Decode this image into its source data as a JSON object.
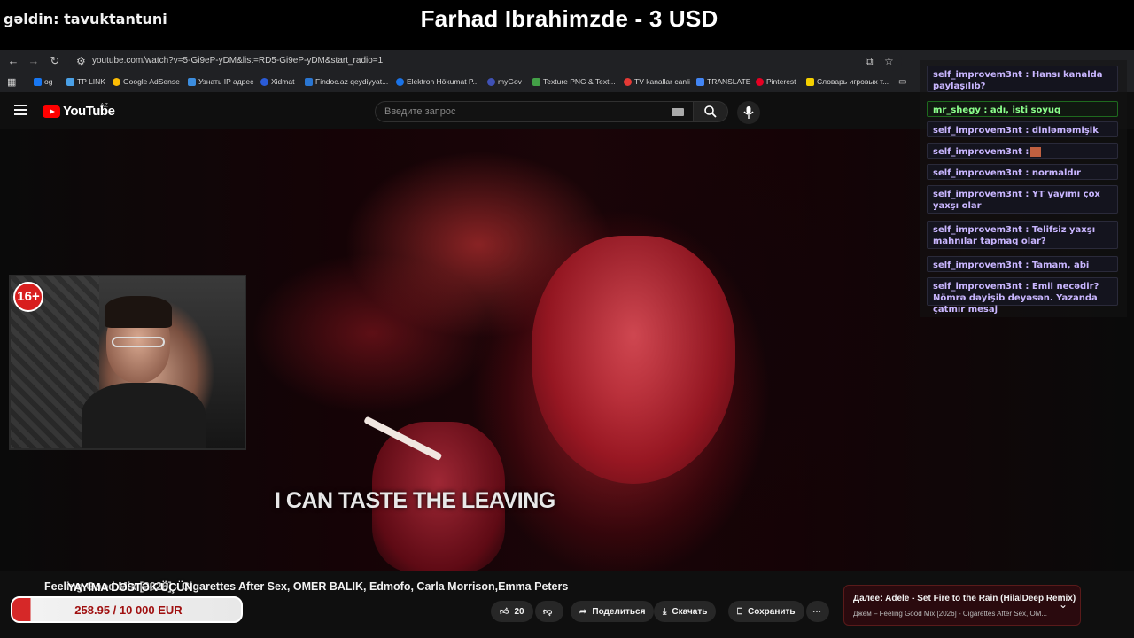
{
  "stream": {
    "greeting": "gəldin: tavuktantuni",
    "title": "Farhad Ibrahimzde - 3 USD",
    "age_badge": "16+",
    "support_text": "YAYIMA DƏSTƏK ÜÇÜN",
    "donation_progress": "258.95 / 10 000 EUR"
  },
  "browser": {
    "url": "youtube.com/watch?v=5-Gi9eP-yDM&list=RD5-Gi9eP-yDM&start_radio=1",
    "bookmarks": [
      {
        "label": "og",
        "color": "#1877f2"
      },
      {
        "label": "TP LINK",
        "color": "#4aa0e6"
      },
      {
        "label": "Google AdSense",
        "color": "#fbbc04"
      },
      {
        "label": "Узнать IP адрес",
        "color": "#3c8dde"
      },
      {
        "label": "Xidmat",
        "color": "#2a5bd7"
      },
      {
        "label": "Findoc.az qeydiyyat...",
        "color": "#2a76d2"
      },
      {
        "label": "Elektron Hökumat P...",
        "color": "#1a73e8"
      },
      {
        "label": "myGov",
        "color": "#3f51b5"
      },
      {
        "label": "Texture PNG & Text...",
        "color": "#43a047"
      },
      {
        "label": "TV kanallar canli",
        "color": "#e53935"
      },
      {
        "label": "TRANSLATE",
        "color": "#4285f4"
      },
      {
        "label": "Pinterest",
        "color": "#e60023"
      },
      {
        "label": "Словарь игровых т...",
        "color": "#f5d000"
      }
    ]
  },
  "youtube": {
    "logo_text": "YouTube",
    "region": "AZ",
    "search_placeholder": "Введите запрос",
    "subtitle": "I CAN TASTE THE LEAVING",
    "video_title": "Feeling Good Mix [2026] - Cigarettes After Sex, OMER BALIK, Edmofo, Carla Morrison,Emma Peters",
    "likes": "20",
    "share_label": "Поделиться",
    "download_label": "Скачать",
    "save_label": "Сохранить",
    "next_title": "Далее: Adele - Set Fire to the Rain (HilalDeep Remix)",
    "next_subtitle": "Джем – Feeling Good Mix [2026] - Cigarettes After Sex, OM..."
  },
  "chat": [
    {
      "text": "self_improvem3nt : Hansı kanalda paylaşılıb?",
      "style": "purple"
    },
    {
      "text": "mr_shegy : adı, isti soyuq",
      "style": "green"
    },
    {
      "text": "self_improvem3nt : dinləməmişik",
      "style": "purple"
    },
    {
      "text": "self_improvem3nt :",
      "style": "purple",
      "emote": true
    },
    {
      "text": "self_improvem3nt : normaldır",
      "style": "purple"
    },
    {
      "text": "self_improvem3nt : YT yayımı çox yaxşı olar",
      "style": "purple"
    },
    {
      "text": "self_improvem3nt : Telifsiz yaxşı mahnılar tapmaq olar?",
      "style": "purple"
    },
    {
      "text": "self_improvem3nt : Tamam, abi",
      "style": "purple"
    },
    {
      "text": "self_improvem3nt : Emil necədir? Nömrə dəyişib deyəsən. Yazanda çatmır mesaj",
      "style": "purple"
    }
  ],
  "icons": {
    "back": "arrow-left-icon",
    "forward": "arrow-right-icon",
    "reload": "reload-icon",
    "search": "search-icon",
    "mic": "mic-icon",
    "like": "thumbs-up-icon",
    "dislike": "thumbs-down-icon",
    "share": "share-icon",
    "download": "download-icon",
    "save": "bookmark-icon",
    "more": "more-horizontal-icon"
  },
  "colors": {
    "youtube_red": "#ff0000",
    "chat_name": "#c9b6ff",
    "chat_green": "#8cff8c",
    "donation_red": "#d62828"
  }
}
